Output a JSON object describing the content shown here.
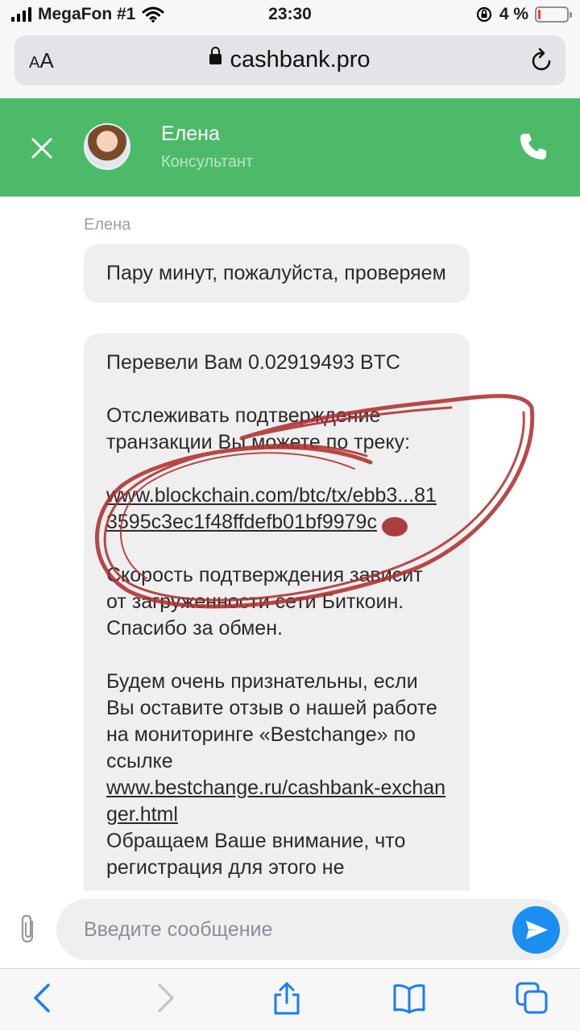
{
  "status_bar": {
    "carrier": "MegaFon #1",
    "time": "23:30",
    "battery_text": "4 %",
    "battery_level": 0.04
  },
  "browser": {
    "text_size_label": "AA",
    "url": "cashbank.pro"
  },
  "chat_header": {
    "agent_name": "Елена",
    "agent_role": "Консультант"
  },
  "messages": {
    "sender": "Елена",
    "bubble1": "Пару минут, пожалуйста, проверяем",
    "bubble2": {
      "line1": "Перевели Вам 0.02919493 BTC",
      "line2": "Отслеживать подтверждение транзакции Вы можете по треку:",
      "tx_link": "www.blockchain.com/btc/tx/ebb3...813595c3ec1f48ffdefb01bf9979c",
      "line3": "Скорость подтверждения зависит от загруженности сети Биткоин. Спасибо за обмен.",
      "line4": "Будем очень признательны, если Вы оставите отзыв о нашей работе на мониторинге «Bestchange» по ссылке",
      "review_link": "www.bestchange.ru/cashbank-exchanger.html",
      "line5": "Обращаем Ваше внимание, что регистрация для этого не"
    }
  },
  "input": {
    "placeholder": "Введите сообщение"
  },
  "colors": {
    "header_green": "#4dba6a",
    "send_blue": "#1a8ff0",
    "ios_blue": "#1a7cf5",
    "scribble_red": "#b03030"
  }
}
